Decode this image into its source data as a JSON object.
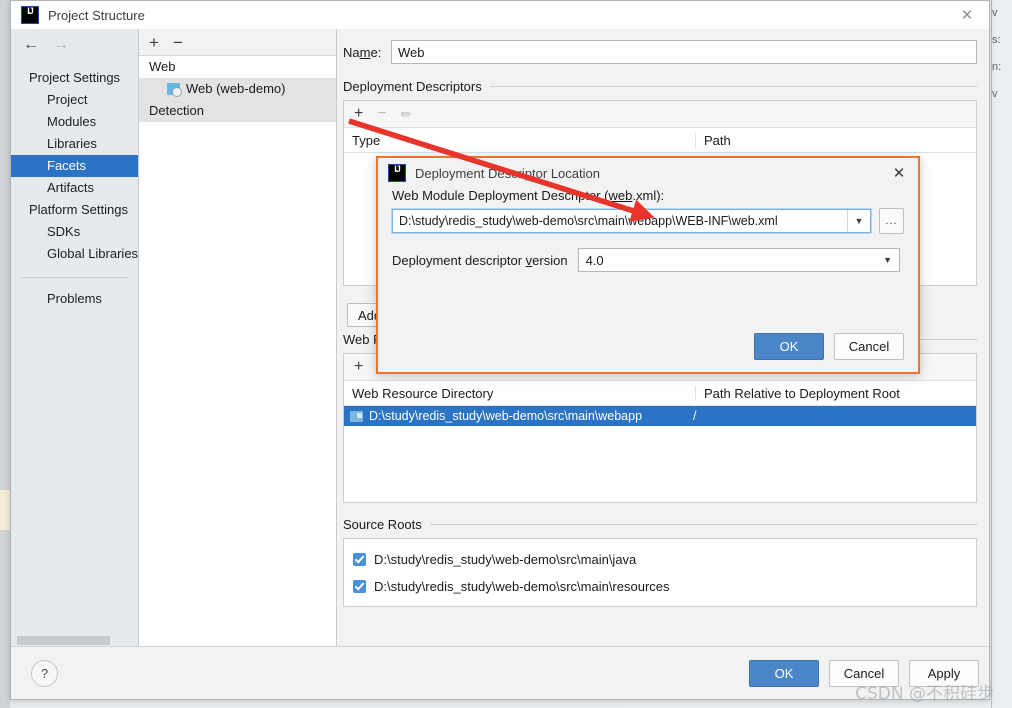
{
  "window": {
    "title": "Project Structure",
    "logo": "intellij-idea-logo",
    "close_icon": "close-icon"
  },
  "background": {
    "right_fragments": [
      "v",
      "s:",
      "n:",
      "v"
    ]
  },
  "sidebar": {
    "back_icon": "back-arrow-icon",
    "forward_icon": "forward-arrow-icon",
    "items": [
      {
        "label": "Project Settings",
        "type": "header",
        "selected": false
      },
      {
        "label": "Project",
        "type": "child",
        "selected": false
      },
      {
        "label": "Modules",
        "type": "child",
        "selected": false
      },
      {
        "label": "Libraries",
        "type": "child",
        "selected": false
      },
      {
        "label": "Facets",
        "type": "child",
        "selected": true
      },
      {
        "label": "Artifacts",
        "type": "child",
        "selected": false
      },
      {
        "label": "Platform Settings",
        "type": "header",
        "selected": false
      },
      {
        "label": "SDKs",
        "type": "child",
        "selected": false
      },
      {
        "label": "Global Libraries",
        "type": "child",
        "selected": false
      }
    ],
    "problems_label": "Problems"
  },
  "tree": {
    "toolbar": {
      "add_icon": "plus-icon",
      "remove_icon": "minus-icon"
    },
    "rows": [
      {
        "label": "Web",
        "kind": "group"
      },
      {
        "label": "Web (web-demo)",
        "kind": "node",
        "icon": "web-facet-icon"
      },
      {
        "label": "Detection",
        "kind": "detection"
      }
    ]
  },
  "main": {
    "name_label_pre": "Na",
    "name_label_mnemonic": "m",
    "name_label_post": "e:",
    "name_value": "Web",
    "deployment_descriptors": {
      "title": "Deployment Descriptors",
      "toolbar": {
        "add_icon": "plus-icon",
        "remove_icon": "minus-icon",
        "edit_icon": "pencil-icon"
      },
      "columns": [
        "Type",
        "Path"
      ],
      "rows": []
    },
    "add_artifact_button": "Add A",
    "web_resource_directories": {
      "title": "Web Resource Directories",
      "toolbar": {
        "add_icon": "plus-icon",
        "remove_icon": "minus-icon",
        "edit_icon": "pencil-icon",
        "help_icon": "question-icon"
      },
      "columns": [
        "Web Resource Directory",
        "Path Relative to Deployment Root"
      ],
      "rows": [
        {
          "directory": "D:\\study\\redis_study\\web-demo\\src\\main\\webapp",
          "relative_path": "/",
          "icon": "folder-icon",
          "selected": true
        }
      ]
    },
    "source_roots": {
      "title": "Source Roots",
      "items": [
        {
          "path": "D:\\study\\redis_study\\web-demo\\src\\main\\java",
          "checked": true
        },
        {
          "path": "D:\\study\\redis_study\\web-demo\\src\\main\\resources",
          "checked": true
        }
      ]
    }
  },
  "dialog": {
    "title": "Deployment Descriptor Location",
    "logo": "intellij-idea-logo",
    "close_icon": "close-icon",
    "descriptor_label_pre": "Web Module Deployment Descriptor (",
    "descriptor_label_mnemonic": "web",
    "descriptor_label_post": ".xml):",
    "descriptor_path": "D:\\study\\redis_study\\web-demo\\src\\main\\webapp\\WEB-INF\\web.xml",
    "dropdown_icon": "chevron-down-icon",
    "browse_button": "...",
    "version_label_pre": "Deployment descriptor ",
    "version_label_mnemonic": "v",
    "version_label_post": "ersion",
    "version_value": "4.0",
    "ok_label": "OK",
    "cancel_label": "Cancel"
  },
  "footer": {
    "help_icon": "question-icon",
    "ok_label": "OK",
    "cancel_label": "Cancel",
    "apply_label": "Apply"
  },
  "annotation": {
    "arrow": "red-arrow-pointing-to-descriptor-path",
    "color": "#e8342a"
  },
  "watermark": "CSDN @不积硅步",
  "colors": {
    "accent_blue": "#2b73c4",
    "button_blue": "#4a86c8",
    "highlight_orange": "#e8762c",
    "annotation_red": "#e8342a"
  }
}
